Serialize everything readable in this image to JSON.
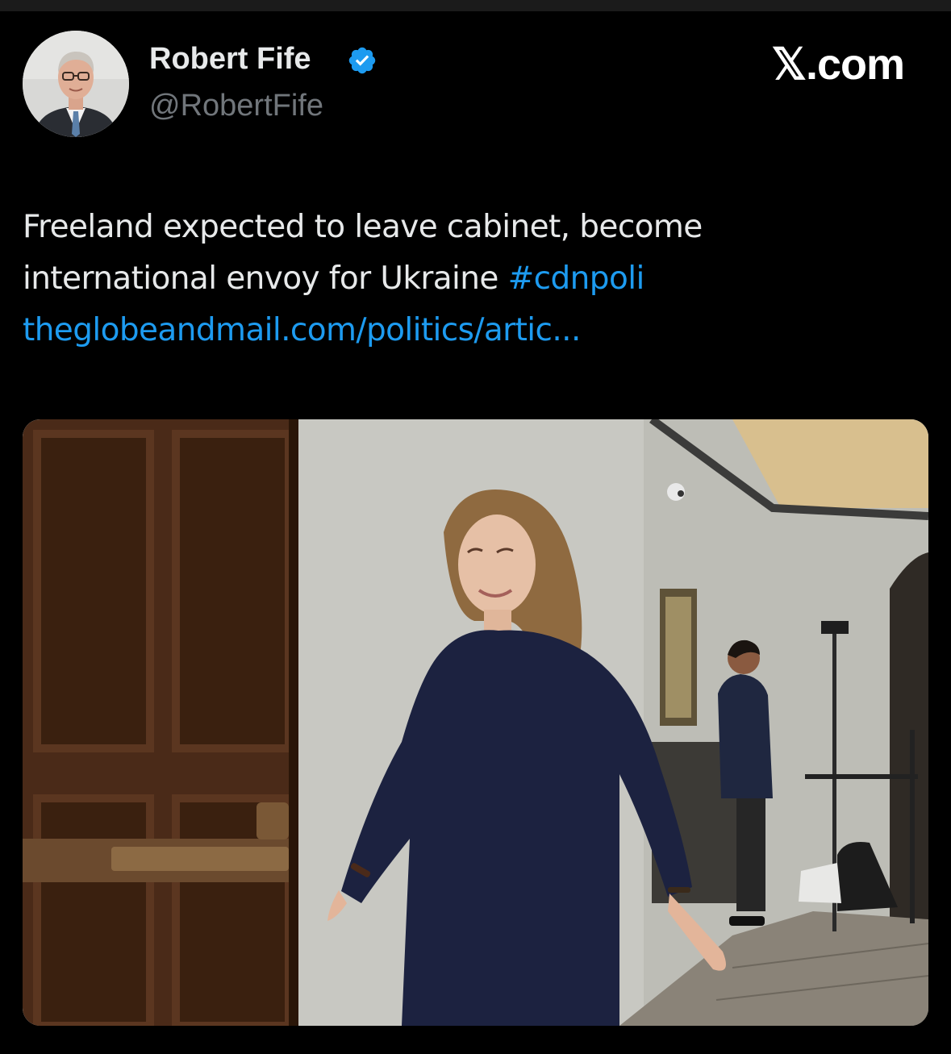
{
  "tweet": {
    "author": {
      "name": "Robert Fife",
      "handle": "@RobertFife",
      "verified": true,
      "avatar_icon": "author-avatar"
    },
    "brand": "𝕏.com",
    "text_line1": "Freeland expected to leave cabinet, become",
    "text_line2": "international envoy for Ukraine ",
    "hashtag": "#cdnpoli",
    "link": "theglobeandmail.com/politics/artic..."
  },
  "colors": {
    "background": "#000000",
    "text": "#e7e9ea",
    "muted": "#71767b",
    "link": "#1d9bf0",
    "verified": "#1d9bf0"
  }
}
